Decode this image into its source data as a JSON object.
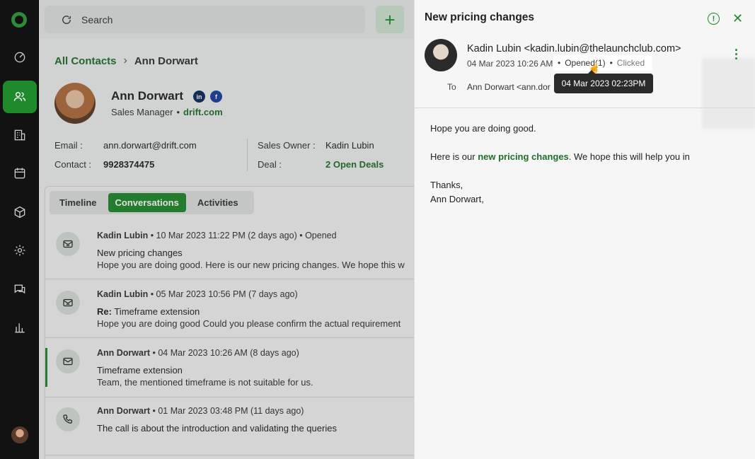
{
  "search": {
    "placeholder": "Search"
  },
  "breadcrumb": {
    "root": "All Contacts",
    "current": "Ann Dorwart"
  },
  "contact": {
    "name": "Ann Dorwart",
    "role": "Sales Manager",
    "website": "drift.com",
    "email_label": "Email :",
    "email": "ann.dorwart@drift.com",
    "contact_label": "Contact :",
    "phone": "9928374475",
    "owner_label": "Sales Owner :",
    "owner": "Kadin Lubin",
    "deal_label": "Deal :",
    "deals": "2 Open Deals"
  },
  "tabs": [
    {
      "label": "Timeline"
    },
    {
      "label": "Conversations"
    },
    {
      "label": "Activities"
    }
  ],
  "conversations": [
    {
      "author": "Kadin Lubin",
      "meta": "10 Mar 2023 11:22 PM (2 days ago)",
      "status": "Opened",
      "subject": "New pricing changes",
      "snippet": "Hope you are doing good. Here is our new pricing changes. We hope this w",
      "icon": "email-out-icon"
    },
    {
      "author": "Kadin Lubin",
      "meta": "05 Mar 2023 10:56 PM (7 days ago)",
      "subject_prefix": "Re:",
      "subject": "Timeframe extension",
      "snippet": "Hope you are doing good Could you please confirm the actual requirement",
      "icon": "email-out-icon"
    },
    {
      "author": "Ann Dorwart",
      "meta": "04 Mar 2023 10:26 AM (8 days ago)",
      "subject": "Timeframe extension",
      "snippet": "Team, the mentioned timeframe is not suitable for us.",
      "icon": "mail-icon"
    },
    {
      "author": "Ann Dorwart",
      "meta": "01 Mar 2023 03:48 PM (11 days ago)",
      "subject": "The call is about the introduction and validating the queries",
      "icon": "phone-icon"
    }
  ],
  "drawer": {
    "title": "New pricing changes",
    "sender": "Kadin Lubin <kadin.lubin@thelaunchclub.com>",
    "sent_date": "04 Mar 2023 10:26 AM",
    "opened": "Opened(1)",
    "clicked": "Clicked",
    "tooltip": "04 Mar 2023 02:23PM",
    "to_label": "To",
    "to_value": "Ann Dorwart <ann.dor",
    "body": {
      "greeting": "Hope you are doing good.",
      "line_prefix": "Here is our",
      "link": "new pricing changes",
      "line_suffix": ". We hope this will help you in",
      "thanks": "Thanks,",
      "signature": "Ann Dorwart,"
    }
  },
  "colors": {
    "accent": "#1f8a2c",
    "sidebar": "#121212"
  }
}
